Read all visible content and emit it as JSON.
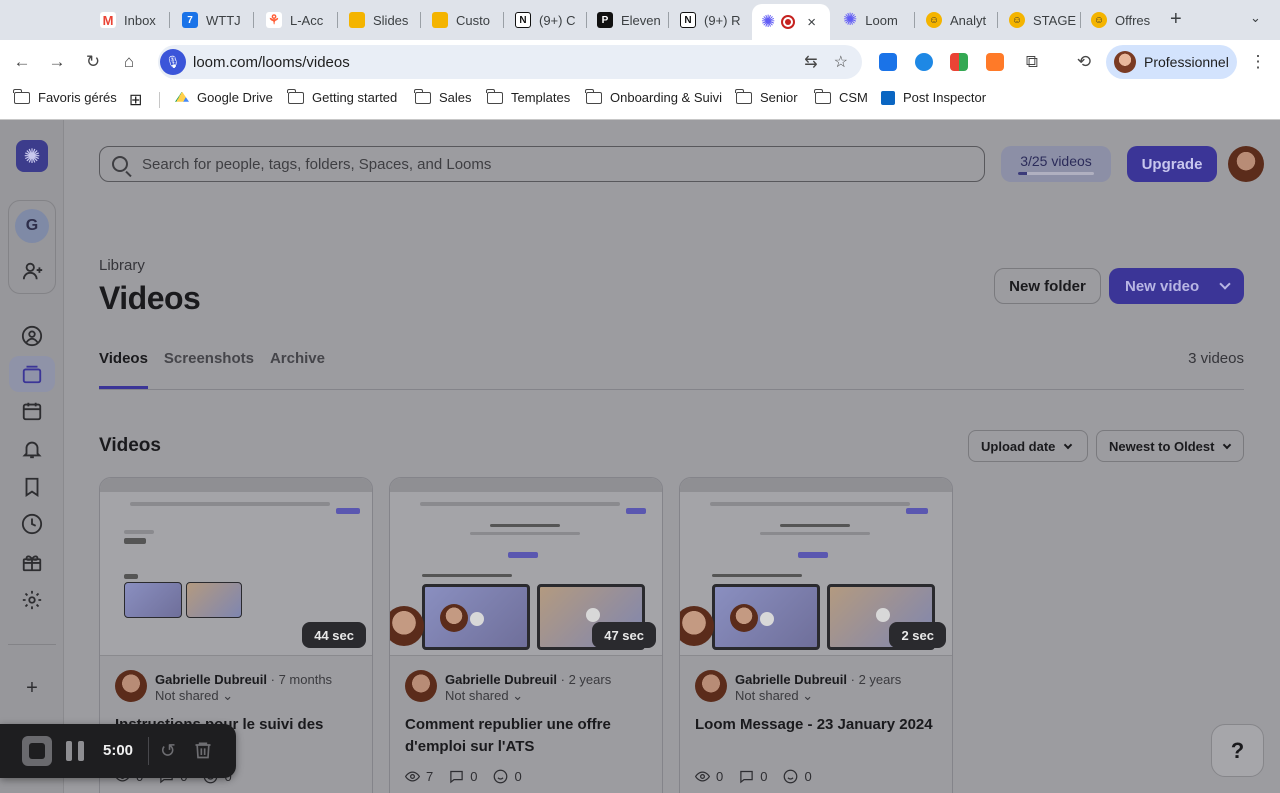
{
  "browser": {
    "tabs": [
      {
        "title": "Inbox",
        "icon": "gmail-icon",
        "color": "#ea4335"
      },
      {
        "title": "WTTJ",
        "icon": "calendar-icon",
        "color": "#1a73e8"
      },
      {
        "title": "L-Acc",
        "icon": "hubspot-icon",
        "color": "#ff5c35"
      },
      {
        "title": "Slides",
        "icon": "slides-icon",
        "color": "#f4b400"
      },
      {
        "title": "Custo",
        "icon": "slides-icon",
        "color": "#f4b400"
      },
      {
        "title": "(9+) C",
        "icon": "notion-icon",
        "color": "#111111"
      },
      {
        "title": "Eleven",
        "icon": "p-icon",
        "color": "#111111"
      },
      {
        "title": "(9+) R",
        "icon": "notion-icon",
        "color": "#111111"
      },
      {
        "title": "Loom",
        "icon": "loom-icon",
        "color": "#625df5"
      },
      {
        "title": "Analyt",
        "icon": "smile-icon",
        "color": "#f4b400"
      },
      {
        "title": "STAGE",
        "icon": "smile-icon",
        "color": "#f4b400"
      },
      {
        "title": "Offres",
        "icon": "smile-icon",
        "color": "#f4b400"
      }
    ],
    "active_tab": {
      "icon": "loom-icon",
      "recording": "recording-icon",
      "close": "×"
    },
    "new_tab": "+",
    "url": "loom.com/looms/videos",
    "profile_label": "Professionnel",
    "bookmarks": [
      {
        "label": "Favoris gérés",
        "icon": "managed-folder-icon"
      },
      {
        "label": "Google Drive",
        "icon": "drive-icon"
      },
      {
        "label": "Getting started",
        "icon": "folder-icon"
      },
      {
        "label": "Sales",
        "icon": "folder-icon"
      },
      {
        "label": "Templates",
        "icon": "folder-icon"
      },
      {
        "label": "Onboarding & Suivi",
        "icon": "folder-icon"
      },
      {
        "label": "Senior",
        "icon": "folder-icon"
      },
      {
        "label": "CSM",
        "icon": "folder-icon"
      },
      {
        "label": "Post Inspector",
        "icon": "linkedin-icon"
      }
    ]
  },
  "app": {
    "workspace_initial": "G",
    "search_placeholder": "Search for people, tags, folders, Spaces, and Looms",
    "quota_label": "3/25 videos",
    "quota_fraction": 0.12,
    "upgrade_label": "Upgrade",
    "breadcrumb": "Library",
    "title": "Videos",
    "new_folder_label": "New folder",
    "new_video_label": "New video",
    "tabs": [
      "Videos",
      "Screenshots",
      "Archive"
    ],
    "video_count": "3 videos",
    "section_title": "Videos",
    "sort_by": "Upload date",
    "sort_order": "Newest to Oldest",
    "help": "?",
    "colors": {
      "accent": "#625df5",
      "overlay_bg": "#9c9ca0"
    }
  },
  "videos": [
    {
      "duration": "44 sec",
      "author": "Gabrielle Dubreuil",
      "age": "7 months",
      "sharing": "Not shared",
      "title": "Instructions pour le suivi des",
      "views": "0",
      "comments": "0",
      "reactions": "0"
    },
    {
      "duration": "47 sec",
      "author": "Gabrielle Dubreuil",
      "age": "2 years",
      "sharing": "Not shared",
      "title": "Comment republier une offre d'emploi sur l'ATS",
      "views": "7",
      "comments": "0",
      "reactions": "0"
    },
    {
      "duration": "2 sec",
      "author": "Gabrielle Dubreuil",
      "age": "2 years",
      "sharing": "Not shared",
      "title": "Loom Message - 23 January 2024",
      "views": "0",
      "comments": "0",
      "reactions": "0"
    }
  ],
  "recorder": {
    "time": "5:00"
  }
}
